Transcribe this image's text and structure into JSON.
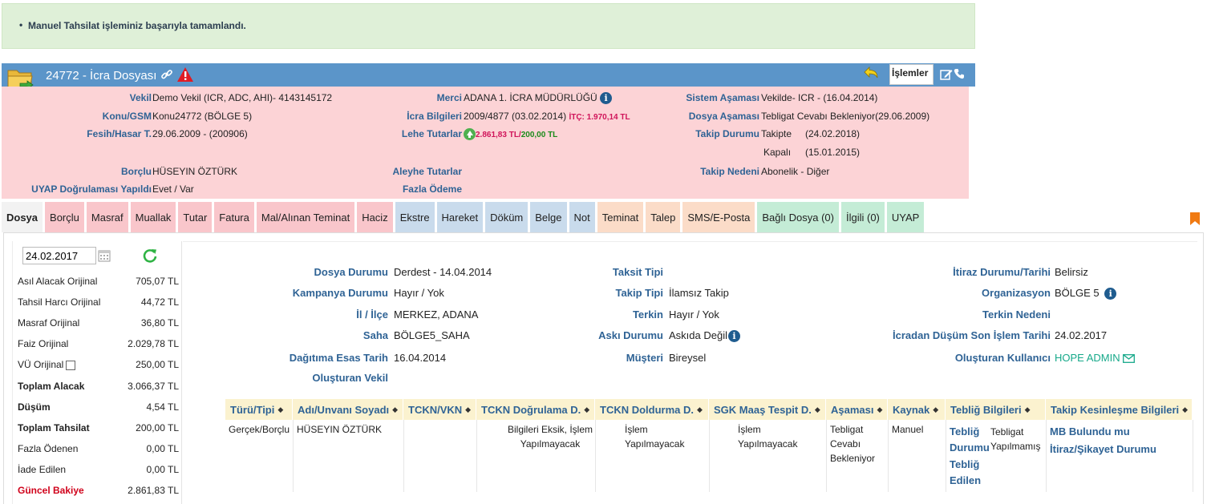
{
  "alert": {
    "message": "Manuel Tahsilat işleminiz başarıyla tamamlandı.",
    "color": "#dff0d8"
  },
  "header": {
    "title": "24772 - İcra Dosyası",
    "actions_label": "İşlemler",
    "bar_color": "#5b95c9"
  },
  "info": {
    "vekil_label": "Vekil",
    "vekil": "Demo Vekil  (ICR, ADC, AHI)- 4143145172",
    "konu_label": "Konu/GSM",
    "konu": "Konu24772 (BÖLGE 5)",
    "fesih_label": "Fesih/Hasar T.",
    "fesih": "29.06.2009 - (200906)",
    "borclu_label": "Borçlu",
    "borclu": "HÜSEYIN ÖZTÜRK",
    "uyap_label": "UYAP Doğrulaması Yapıldı",
    "uyap": "Evet / Var",
    "merci_label": "Merci",
    "merci": "ADANA 1. İCRA MÜDÜRLÜĞÜ",
    "icra_label": "İcra Bilgileri",
    "icra": "2009/4877 (03.02.2014)",
    "itc": "İTÇ: 1.970,14 TL",
    "lehe_label": "Lehe Tutarlar",
    "lehe_red": "2.861,83 TL",
    "lehe_sep": "/",
    "lehe_green": "200,00 TL",
    "aleyhe_label": "Aleyhe Tutarlar",
    "fazla_label": "Fazla Ödeme",
    "sistem_label": "Sistem Aşaması",
    "sistem": "Vekilde- ICR - (16.04.2014)",
    "dosya_asamasi_label": "Dosya Aşaması",
    "dosya_asamasi": "Tebligat Cevabı Bekleniyor(29.06.2009)",
    "takip_label": "Takip Durumu",
    "takip1": "Takipte",
    "takip1_date": "(24.02.2018)",
    "takip2": "Kapalı",
    "takip2_date": "(15.01.2015)",
    "neden_label": "Takip Nedeni",
    "neden": "Abonelik - Diğer"
  },
  "tabs": [
    {
      "label": "Dosya",
      "style": "active"
    },
    {
      "label": "Borçlu",
      "style": "red"
    },
    {
      "label": "Masraf",
      "style": "red"
    },
    {
      "label": "Muallak",
      "style": "red"
    },
    {
      "label": "Tutar",
      "style": "red"
    },
    {
      "label": "Fatura",
      "style": "red"
    },
    {
      "label": "Mal/Alınan Teminat",
      "style": "red"
    },
    {
      "label": "Haciz",
      "style": "red"
    },
    {
      "label": "Ekstre",
      "style": "blue"
    },
    {
      "label": "Hareket",
      "style": "blue"
    },
    {
      "label": "Döküm",
      "style": "blue"
    },
    {
      "label": "Belge",
      "style": "blue"
    },
    {
      "label": "Not",
      "style": "blue"
    },
    {
      "label": "Teminat",
      "style": "orange"
    },
    {
      "label": "Talep",
      "style": "orange"
    },
    {
      "label": "SMS/E-Posta",
      "style": "orange"
    },
    {
      "label": "Bağlı Dosya (0)",
      "style": "green"
    },
    {
      "label": "İlgili (0)",
      "style": "green"
    },
    {
      "label": "UYAP",
      "style": "green"
    }
  ],
  "summary": {
    "date": "24.02.2017",
    "rows": [
      {
        "label": "Asıl Alacak Orijinal",
        "value": "705,07 TL",
        "style": ""
      },
      {
        "label": "Tahsil Harcı Orijinal",
        "value": "44,72 TL",
        "style": ""
      },
      {
        "label": "Masraf Orijinal",
        "value": "36,80 TL",
        "style": ""
      },
      {
        "label": "Faiz Orijinal",
        "value": "2.029,78 TL",
        "style": ""
      },
      {
        "label": "VÜ Orijinal",
        "value": "250,00 TL",
        "style": "chk"
      },
      {
        "label": "Toplam Alacak",
        "value": "3.066,37 TL",
        "style": "bold"
      },
      {
        "label": "Düşüm",
        "value": "4,54 TL",
        "style": "bold"
      },
      {
        "label": "Toplam Tahsilat",
        "value": "200,00 TL",
        "style": "bold"
      },
      {
        "label": "Fazla Ödenen",
        "value": "0,00 TL",
        "style": ""
      },
      {
        "label": "İade Edilen",
        "value": "0,00 TL",
        "style": ""
      },
      {
        "label": "Güncel Bakiye",
        "value": "2.861,83 TL",
        "style": "red"
      }
    ]
  },
  "details": {
    "dosya_durumu_label": "Dosya Durumu",
    "dosya_durumu": "Derdest - 14.04.2014",
    "kampanya_label": "Kampanya Durumu",
    "kampanya": "Hayır / Yok",
    "il_label": "İl / İlçe",
    "il": "MERKEZ, ADANA",
    "saha_label": "Saha",
    "saha": "BÖLGE5_SAHA",
    "dagitim_label": "Dağıtıma Esas Tarih",
    "dagitim": "16.04.2014",
    "olusturan_vekil_label": "Oluşturan Vekil",
    "taksit_label": "Taksit Tipi",
    "takip_tipi_label": "Takip Tipi",
    "takip_tipi": "İlamsız Takip",
    "terkin_label": "Terkin",
    "terkin": "Hayır / Yok",
    "aski_label": "Askı Durumu",
    "aski": "Askıda Değil",
    "musteri_label": "Müşteri",
    "musteri": "Bireysel",
    "itiraz_label": "İtiraz Durumu/Tarihi",
    "itiraz": "Belirsiz",
    "org_label": "Organizasyon",
    "org": "BÖLGE 5",
    "terkin_neden_label": "Terkin Nedeni",
    "icradan_label": "İcradan Düşüm Son İşlem Tarihi",
    "icradan": "24.02.2017",
    "olusturan_kullanici_label": "Oluşturan Kullanıcı",
    "olusturan_kullanici": "HOPE ADMIN"
  },
  "table": {
    "columns": [
      "Türü/Tipi",
      "Adı/Unvanı Soyadı",
      "TCKN/VKN",
      "TCKN Doğrulama D.",
      "TCKN Doldurma D.",
      "SGK Maaş Tespit D.",
      "Aşaması",
      "Kaynak",
      "Tebliğ Bilgileri",
      "Takip Kesinleşme Bilgileri"
    ],
    "row": {
      "turu": "Gerçek/Borçlu",
      "adi": "HÜSEYIN ÖZTÜRK",
      "dogrulama": "Bilgileri Eksik, İşlem Yapılmayacak",
      "doldurma": "İşlem Yapılmayacak",
      "sgk": "İşlem Yapılmayacak",
      "asamasi": "Tebligat Cevabı Bekleniyor",
      "kaynak": "Manuel",
      "teblig_durumu_label": "Tebliğ Durumu",
      "teblig_durumu": "Tebligat Yapılmamış",
      "teblig_edilen_label": "Tebliğ Edilen",
      "mb_label": "MB Bulundu mu",
      "itiraz_label": "İtiraz/Şikayet Durumu"
    }
  }
}
